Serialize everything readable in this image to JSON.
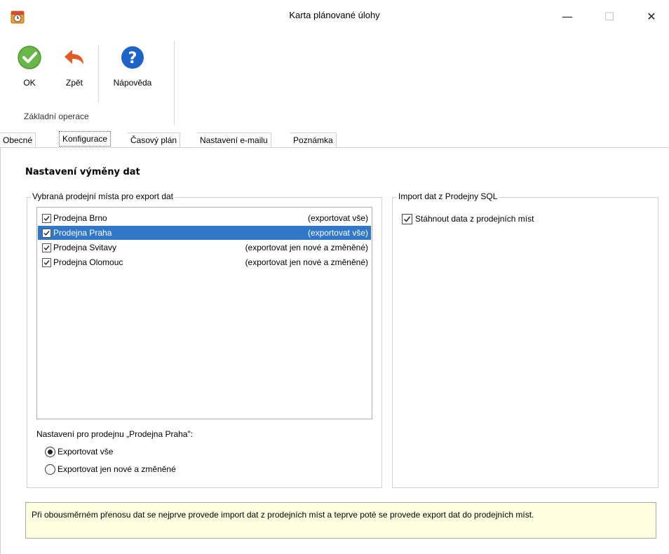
{
  "window": {
    "title": "Karta plánované úlohy",
    "minimize_glyph": "—",
    "maximize_glyph": "☐",
    "close_glyph": "✕"
  },
  "ribbon": {
    "ok_label": "OK",
    "back_label": "Zpět",
    "help_label": "Nápověda",
    "group_label": "Základní operace",
    "ok_icon": "check-circle-icon",
    "back_icon": "undo-arrow-icon",
    "help_icon": "help-question-icon",
    "colors": {
      "ok": "#6ab64a",
      "back": "#e35a24",
      "help": "#1f63c6"
    }
  },
  "tabs": [
    {
      "label": "Obecné",
      "active": false
    },
    {
      "label": "Konfigurace",
      "active": true
    },
    {
      "label": "Časový plán",
      "active": false
    },
    {
      "label": "Nastavení e-mailu",
      "active": false
    },
    {
      "label": "Poznámka",
      "active": false
    }
  ],
  "content": {
    "section_title": "Nastavení výměny dat",
    "export_group": {
      "legend": "Vybraná prodejní místa pro export dat",
      "stores": [
        {
          "name": "Prodejna Brno",
          "mode": "(exportovat vše)",
          "checked": true,
          "selected": false
        },
        {
          "name": "Prodejna Praha",
          "mode": "(exportovat vše)",
          "checked": true,
          "selected": true
        },
        {
          "name": "Prodejna Svitavy",
          "mode": "(exportovat jen nové a změněné)",
          "checked": true,
          "selected": false
        },
        {
          "name": "Prodejna Olomouc",
          "mode": "(exportovat jen nové a změněné)",
          "checked": true,
          "selected": false
        }
      ],
      "settings_label": "Nastavení pro prodejnu „Prodejna Praha\":",
      "radio_all": "Exportovat vše",
      "radio_new": "Exportovat jen nové a změněné",
      "selected_radio": "all"
    },
    "import_group": {
      "legend": "Import dat z Prodejny SQL",
      "checkbox_label": "Stáhnout data z prodejních míst",
      "checked": true
    },
    "info_text": "Při obousměrném přenosu dat se nejprve provede import dat z prodejních míst a teprve poté se provede export dat do prodejních míst."
  },
  "colors": {
    "selection": "#3177c8",
    "info_bg": "#ffffe1"
  }
}
